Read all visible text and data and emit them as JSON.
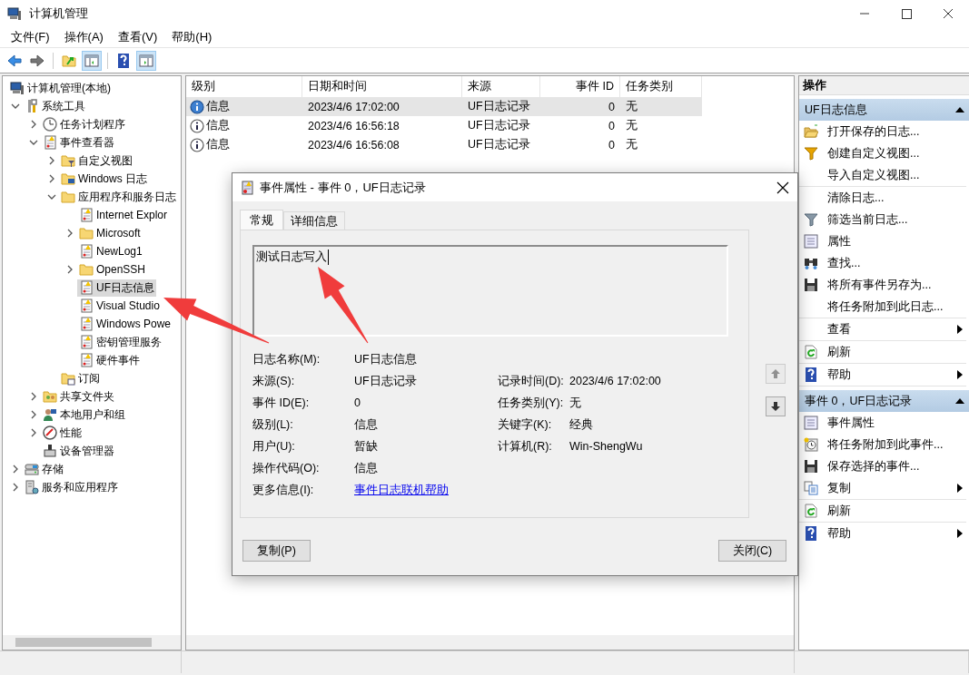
{
  "window": {
    "title": "计算机管理"
  },
  "menu": [
    "文件(F)",
    "操作(A)",
    "查看(V)",
    "帮助(H)"
  ],
  "tree": [
    {
      "label": "计算机管理(本地)",
      "kind": "computer",
      "selected": false,
      "children": [
        {
          "label": "系统工具",
          "kind": "tools",
          "expanded": true,
          "selected": false,
          "children": [
            {
              "label": "任务计划程序",
              "kind": "clock",
              "expanded": false,
              "selected": false
            },
            {
              "label": "事件查看器",
              "kind": "log",
              "expanded": true,
              "selected": false,
              "children": [
                {
                  "label": "自定义视图",
                  "kind": "filterfolder",
                  "expanded": false,
                  "selected": false
                },
                {
                  "label": "Windows 日志",
                  "kind": "pcfolder",
                  "expanded": false,
                  "selected": false
                },
                {
                  "label": "应用程序和服务日志",
                  "kind": "folder",
                  "expanded": true,
                  "selected": false,
                  "children": [
                    {
                      "label": "Internet Explor",
                      "kind": "log",
                      "selected": false
                    },
                    {
                      "label": "Microsoft",
                      "kind": "folder",
                      "expanded": false,
                      "selected": false
                    },
                    {
                      "label": "NewLog1",
                      "kind": "log",
                      "selected": false
                    },
                    {
                      "label": "OpenSSH",
                      "kind": "folder",
                      "expanded": false,
                      "selected": false
                    },
                    {
                      "label": "UF日志信息",
                      "kind": "log",
                      "selected": true
                    },
                    {
                      "label": "Visual Studio",
                      "kind": "log",
                      "selected": false
                    },
                    {
                      "label": "Windows Powe",
                      "kind": "log",
                      "selected": false
                    },
                    {
                      "label": "密钥管理服务",
                      "kind": "log",
                      "selected": false
                    },
                    {
                      "label": "硬件事件",
                      "kind": "log",
                      "selected": false
                    }
                  ]
                },
                {
                  "label": "订阅",
                  "kind": "subfolder",
                  "selected": false
                }
              ]
            },
            {
              "label": "共享文件夹",
              "kind": "share",
              "expanded": false,
              "selected": false
            },
            {
              "label": "本地用户和组",
              "kind": "users",
              "expanded": false,
              "selected": false
            },
            {
              "label": "性能",
              "kind": "perf",
              "expanded": false,
              "selected": false
            },
            {
              "label": "设备管理器",
              "kind": "device",
              "selected": false
            }
          ]
        },
        {
          "label": "存储",
          "kind": "storage",
          "expanded": false,
          "selected": false
        },
        {
          "label": "服务和应用程序",
          "kind": "services",
          "expanded": false,
          "selected": false
        }
      ]
    }
  ],
  "events": {
    "columns": [
      "级别",
      "日期和时间",
      "来源",
      "事件 ID",
      "任务类别"
    ],
    "rows": [
      {
        "level": "信息",
        "date": "2023/4/6 17:02:00",
        "source": "UF日志记录",
        "event_id": "0",
        "category": "无",
        "selected": true
      },
      {
        "level": "信息",
        "date": "2023/4/6 16:56:18",
        "source": "UF日志记录",
        "event_id": "0",
        "category": "无",
        "selected": false
      },
      {
        "level": "信息",
        "date": "2023/4/6 16:56:08",
        "source": "UF日志记录",
        "event_id": "0",
        "category": "无",
        "selected": false
      }
    ]
  },
  "actions": {
    "title": "操作",
    "sections": [
      {
        "title": "UF日志信息",
        "expanded": true,
        "groups": [
          [
            {
              "label": "打开保存的日志...",
              "kind": "open",
              "submenu": false
            },
            {
              "label": "创建自定义视图...",
              "kind": "funnelnew",
              "submenu": false
            },
            {
              "label": "导入自定义视图...",
              "kind": "none",
              "submenu": false
            }
          ],
          [
            {
              "label": "清除日志...",
              "kind": "none",
              "submenu": false
            },
            {
              "label": "筛选当前日志...",
              "kind": "funnel",
              "submenu": false
            },
            {
              "label": "属性",
              "kind": "props",
              "submenu": false
            },
            {
              "label": "查找...",
              "kind": "find",
              "submenu": false
            },
            {
              "label": "将所有事件另存为...",
              "kind": "save",
              "submenu": false
            },
            {
              "label": "将任务附加到此日志...",
              "kind": "none",
              "submenu": false
            }
          ],
          [
            {
              "label": "查看",
              "kind": "none",
              "submenu": true
            }
          ],
          [
            {
              "label": "刷新",
              "kind": "refresh",
              "submenu": false
            }
          ],
          [
            {
              "label": "帮助",
              "kind": "help",
              "submenu": true
            }
          ]
        ]
      },
      {
        "title": "事件 0，UF日志记录",
        "expanded": true,
        "groups": [
          [
            {
              "label": "事件属性",
              "kind": "props",
              "submenu": false
            },
            {
              "label": "将任务附加到此事件...",
              "kind": "task",
              "submenu": false
            },
            {
              "label": "保存选择的事件...",
              "kind": "save",
              "submenu": false
            },
            {
              "label": "复制",
              "kind": "copy",
              "submenu": true
            }
          ],
          [
            {
              "label": "刷新",
              "kind": "refresh",
              "submenu": false
            }
          ],
          [
            {
              "label": "帮助",
              "kind": "help",
              "submenu": true
            }
          ]
        ]
      }
    ]
  },
  "dialog": {
    "title": "事件属性 - 事件 0，UF日志记录",
    "tabs": [
      {
        "label": "常规",
        "selected": true
      },
      {
        "label": "详细信息",
        "selected": false
      }
    ],
    "message": "测试日志写入",
    "fields": [
      {
        "label": "日志名称(M):",
        "value": "UF日志信息"
      },
      {
        "label": "来源(S):",
        "value": "UF日志记录",
        "label_2": "记录时间(D):",
        "value_2": "2023/4/6 17:02:00"
      },
      {
        "label": "事件 ID(E):",
        "value": "0",
        "label_2": "任务类别(Y):",
        "value_2": "无"
      },
      {
        "label": "级别(L):",
        "value": "信息",
        "label_2": "关键字(K):",
        "value_2": "经典"
      },
      {
        "label": "用户(U):",
        "value": "暂缺",
        "label_2": "计算机(R):",
        "value_2": "Win-ShengWu"
      },
      {
        "label": "操作代码(O):",
        "value": "信息"
      },
      {
        "label": "更多信息(I):",
        "link": "事件日志联机帮助"
      }
    ],
    "buttons": [
      "复制(P)",
      "关闭(C)"
    ]
  }
}
